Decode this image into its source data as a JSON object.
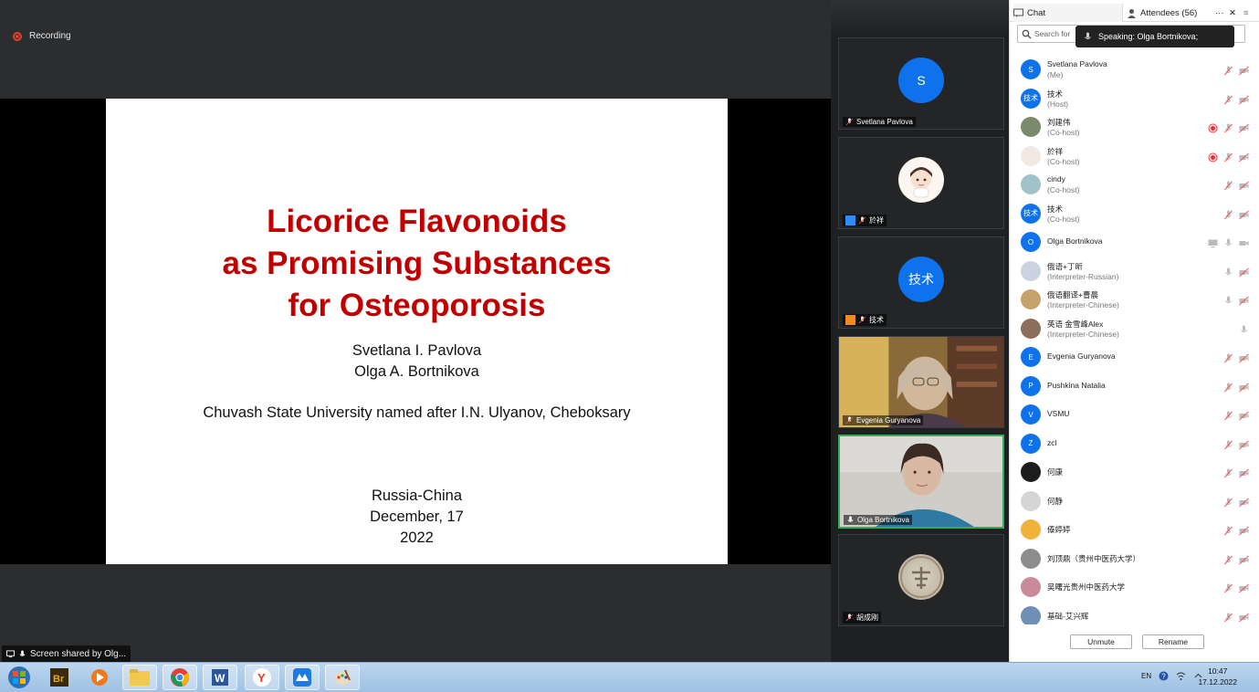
{
  "share": {
    "recording_label": "Recording",
    "screen_shared_label": "Screen shared by Olg...",
    "slide": {
      "title_lines": [
        "Licorice Flavonoids",
        "as Promising Substances",
        "for Osteoporosis"
      ],
      "authors": [
        "Svetlana I. Pavlova",
        "Olga A. Bortnikova"
      ],
      "affiliation": "Chuvash State University named after I.N. Ulyanov, Cheboksary",
      "event": "Russia-China",
      "date": "December, 17",
      "year": "2022"
    }
  },
  "videos": [
    {
      "name": "Svetlana Pavlova",
      "avatar": "S",
      "kind": "initial"
    },
    {
      "name": "於祥",
      "kind": "cartoon"
    },
    {
      "name": "技术",
      "avatar": "技术",
      "kind": "initial"
    },
    {
      "name": "Evgenia Guryanova",
      "kind": "video"
    },
    {
      "name": "Olga Bortnikova",
      "kind": "video"
    },
    {
      "name": "胡成刚",
      "kind": "stamp"
    }
  ],
  "panel": {
    "chat_tab": "Chat",
    "attendees_tab": "Attendees (56)",
    "more": "···",
    "close": "✕",
    "menu": "≡",
    "search_placeholder": "Search for",
    "speaking": "Speaking: Olga Bortnikova;",
    "attendees": [
      {
        "name": "Svetlana Pavlova",
        "role": "(Me)",
        "avatar": "S",
        "color": "#0e72ed",
        "rec": false
      },
      {
        "name": "技术",
        "role": "(Host)",
        "avatar": "技术",
        "color": "#0e72ed",
        "rec": false
      },
      {
        "name": "刘建伟",
        "role": "(Co-host)",
        "avatar": "",
        "color": "#7a8a6a",
        "rec": true
      },
      {
        "name": "於祥",
        "role": "(Co-host)",
        "avatar": "",
        "color": "#f2e9e2",
        "rec": true
      },
      {
        "name": "cindy",
        "role": "(Co-host)",
        "avatar": "",
        "color": "#9fc3c8",
        "rec": false
      },
      {
        "name": "技术",
        "role": "(Co-host)",
        "avatar": "技术",
        "color": "#0e72ed",
        "rec": false
      },
      {
        "name": "Olga Bortnikova",
        "role": "",
        "avatar": "O",
        "color": "#0e72ed",
        "rec": false
      },
      {
        "name": "俄语+丁昕",
        "role": "(Interpreter-Russian)",
        "avatar": "",
        "color": "#c9d4e0",
        "rec": false
      },
      {
        "name": "俄语翻译+曹晨",
        "role": "(Interpreter-Chinese)",
        "avatar": "",
        "color": "#c5a36b",
        "rec": false
      },
      {
        "name": "英语 金雪峰Alex",
        "role": "(Interpreter-Chinese)",
        "avatar": "",
        "color": "#8b6f5a",
        "rec": false
      },
      {
        "name": "Evgenia Guryanova",
        "role": "",
        "avatar": "E",
        "color": "#0e72ed",
        "rec": false
      },
      {
        "name": "Pushkina Natalia",
        "role": "",
        "avatar": "P",
        "color": "#0e72ed",
        "rec": false
      },
      {
        "name": "VSMU",
        "role": "",
        "avatar": "V",
        "color": "#0e72ed",
        "rec": false
      },
      {
        "name": "zcl",
        "role": "",
        "avatar": "Z",
        "color": "#0e72ed",
        "rec": false
      },
      {
        "name": "何康",
        "role": "",
        "avatar": "",
        "color": "#1d1d1d",
        "rec": false
      },
      {
        "name": "何静",
        "role": "",
        "avatar": "",
        "color": "#d5d5d5",
        "rec": false
      },
      {
        "name": "傣婷婷",
        "role": "",
        "avatar": "",
        "color": "#f0b23a",
        "rec": false
      },
      {
        "name": "刘顶鼎（贵州中医药大学）",
        "role": "",
        "avatar": "",
        "color": "#8d8d8d",
        "rec": false
      },
      {
        "name": "吴曙光贵州中医药大学",
        "role": "",
        "avatar": "",
        "color": "#c98a9a",
        "rec": false
      },
      {
        "name": "基础-艾兴辉",
        "role": "",
        "avatar": "",
        "color": "#6f8fb5",
        "rec": false
      }
    ],
    "unmute_label": "Unmute",
    "rename_label": "Rename"
  },
  "taskbar": {
    "lang": "EN",
    "time": "10:47",
    "date": "17.12.2022",
    "apps": [
      "windows-start",
      "adobe-bridge",
      "media-player",
      "file-explorer",
      "chrome",
      "word",
      "yandex-browser",
      "voov-meeting",
      "paint"
    ]
  }
}
